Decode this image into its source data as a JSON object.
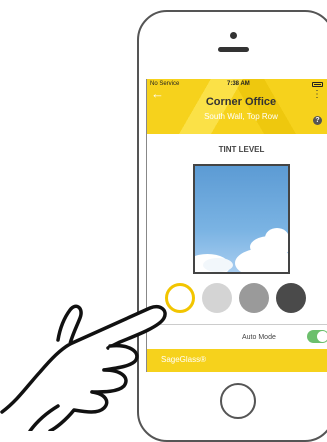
{
  "status_bar": {
    "carrier": "No Service",
    "time": "7:38 AM"
  },
  "header": {
    "title": "Corner Office",
    "subtitle": "South Wall, Top Row",
    "help_icon_text": "?"
  },
  "main": {
    "section_label": "TINT LEVEL"
  },
  "tints": [
    {
      "name": "clear",
      "color": "#ffffff",
      "selected": true
    },
    {
      "name": "light",
      "color": "#d4d4d4",
      "selected": false
    },
    {
      "name": "medium",
      "color": "#9a9a9a",
      "selected": false
    },
    {
      "name": "dark",
      "color": "#4a4a4a",
      "selected": false
    }
  ],
  "auto_mode": {
    "label": "Auto Mode",
    "on": true
  },
  "footer": {
    "brand": "SageGlass®"
  },
  "colors": {
    "accent": "#f6d21c",
    "selected_ring": "#f2c500",
    "toggle_on": "#6cbf6c"
  },
  "icons": {
    "back": "back-arrow-icon",
    "menu": "menu-dots-icon",
    "help": "help-icon",
    "wifi": "wifi-icon",
    "battery": "battery-icon"
  }
}
